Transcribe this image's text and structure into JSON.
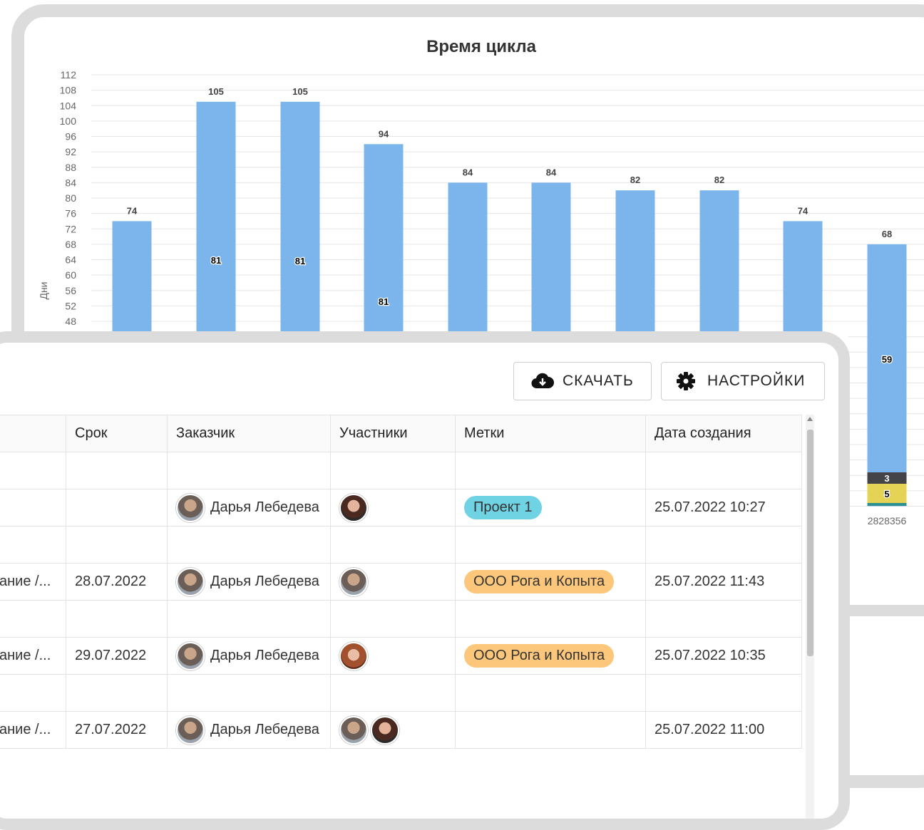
{
  "chart_data": {
    "type": "bar",
    "title": "Время цикла",
    "ylabel": "Дни",
    "yticks": [
      48,
      52,
      56,
      60,
      64,
      68,
      72,
      76,
      80,
      84,
      88,
      92,
      96,
      100,
      104,
      108,
      112
    ],
    "ylim": [
      0,
      112
    ],
    "grid": true,
    "categories": [
      "",
      "",
      "",
      "",
      "",
      "",
      "",
      "",
      "",
      "2828356"
    ],
    "values": [
      74,
      105,
      105,
      94,
      84,
      84,
      82,
      82,
      74,
      68
    ],
    "inner_labels": [
      "",
      "81",
      "81",
      "81",
      "",
      "",
      "",
      "",
      "",
      "59"
    ],
    "stack_labels": [
      "",
      "3",
      "5"
    ],
    "bar_color": "#7cb5ec"
  },
  "toolbar": {
    "download_label": "СКАЧАТЬ",
    "download_icon": "cloud-download-icon",
    "settings_label": "НАСТРОЙКИ",
    "settings_icon": "gear-icon"
  },
  "table": {
    "headers": [
      "Срок",
      "Заказчик",
      "Участники",
      "Метки",
      "Дата создания"
    ],
    "rows": [
      {
        "prefix": "",
        "deadline": "",
        "customer": "",
        "tag": "",
        "created": ""
      },
      {
        "prefix": "",
        "deadline": "",
        "customer": "Дарья Лебедева",
        "tag": "Проект 1",
        "created": "25.07.2022 10:27"
      },
      {
        "prefix": "",
        "deadline": "",
        "customer": "",
        "tag": "",
        "created": ""
      },
      {
        "prefix": "ание /...",
        "deadline": "28.07.2022",
        "customer": "Дарья Лебедева",
        "tag": "ООО Рога и Копыта",
        "created": "25.07.2022 11:43"
      },
      {
        "prefix": "",
        "deadline": "",
        "customer": "",
        "tag": "",
        "created": ""
      },
      {
        "prefix": "ание /...",
        "deadline": "29.07.2022",
        "customer": "Дарья Лебедева",
        "tag": "ООО Рога и Копыта",
        "created": "25.07.2022 10:35"
      },
      {
        "prefix": "",
        "deadline": "",
        "customer": "",
        "tag": "",
        "created": ""
      },
      {
        "prefix": "ание /...",
        "deadline": "27.07.2022",
        "customer": "Дарья Лебедева",
        "tag": "",
        "created": "25.07.2022 11:00"
      }
    ]
  },
  "colors": {
    "tag_project": "#6fd3e4",
    "tag_company": "#fcc77a",
    "stack_dark": "#434348",
    "stack_yellow": "#e4d354",
    "stack_teal": "#2b908f"
  }
}
